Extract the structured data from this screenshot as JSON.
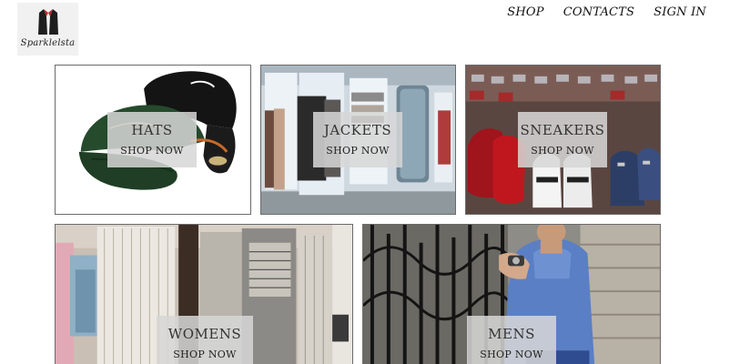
{
  "brand": {
    "name": "Sparklelsta",
    "logo_icon": "jacket-icon"
  },
  "nav": {
    "items": [
      {
        "label": "SHOP"
      },
      {
        "label": "CONTACTS"
      },
      {
        "label": "SIGN IN"
      }
    ]
  },
  "tiles": [
    {
      "title": "HATS",
      "cta": "SHOP NOW",
      "image": "hats-photo"
    },
    {
      "title": "JACKETS",
      "cta": "SHOP NOW",
      "image": "jackets-store-photo"
    },
    {
      "title": "SNEAKERS",
      "cta": "SHOP NOW",
      "image": "sneakers-wall-photo"
    },
    {
      "title": "WOMENS",
      "cta": "SHOP NOW",
      "image": "womens-clothing-rack-photo"
    },
    {
      "title": "MENS",
      "cta": "SHOP NOW",
      "image": "mens-model-photo"
    }
  ],
  "colors": {
    "label_overlay": "#d6d6d6",
    "tile_border": "#6b6b6b",
    "text": "#111111"
  }
}
